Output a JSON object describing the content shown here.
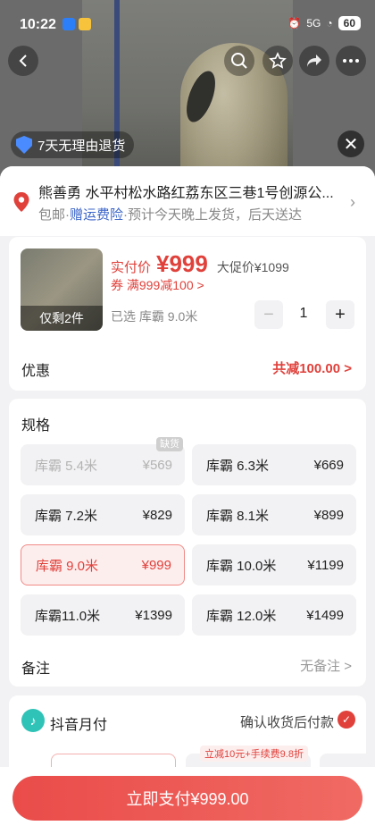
{
  "status_bar": {
    "time": "10:22",
    "network": "5G",
    "battery": "60"
  },
  "hero": {
    "return_policy": "7天无理由退货"
  },
  "address": {
    "line1": "熊善勇  水平村松水路红荔东区三巷1号创源公...",
    "free_shipping": "包邮",
    "insurance": "赠运费险",
    "eta": "预计今天晚上发货，后天送达"
  },
  "product": {
    "stock_label": "仅剩2件",
    "price_label": "实付价",
    "price": "¥999",
    "promo_price": "大促价¥1099",
    "coupon": "券 满999减100 >",
    "selected": "已选 库霸  9.0米",
    "quantity": "1",
    "minus": "−",
    "plus": "+"
  },
  "discount": {
    "label": "优惠",
    "value": "共减100.00 >"
  },
  "spec": {
    "title": "规格",
    "out_of_stock_tag": "缺货",
    "options": [
      {
        "name": "库霸  5.4米",
        "price": "¥569",
        "state": "disabled"
      },
      {
        "name": "库霸  6.3米",
        "price": "¥669",
        "state": "normal"
      },
      {
        "name": "库霸  7.2米",
        "price": "¥829",
        "state": "normal"
      },
      {
        "name": "库霸  8.1米",
        "price": "¥899",
        "state": "normal"
      },
      {
        "name": "库霸  9.0米",
        "price": "¥999",
        "state": "selected"
      },
      {
        "name": "库霸  10.0米",
        "price": "¥1199",
        "state": "normal"
      },
      {
        "name": "库霸11.0米",
        "price": "¥1399",
        "state": "normal"
      },
      {
        "name": "库霸  12.0米",
        "price": "¥1499",
        "state": "normal"
      }
    ]
  },
  "note": {
    "label": "备注",
    "value": "无备注 >"
  },
  "payment": {
    "method": "抖音月付",
    "right": "确认收货后付款",
    "promo_tag": "立减10元+手续费9.8折"
  },
  "buy_button": "立即支付¥999.00",
  "colors": {
    "accent": "#e0413b",
    "link": "#3a64c8",
    "pay_brand": "#2fc3b8"
  }
}
